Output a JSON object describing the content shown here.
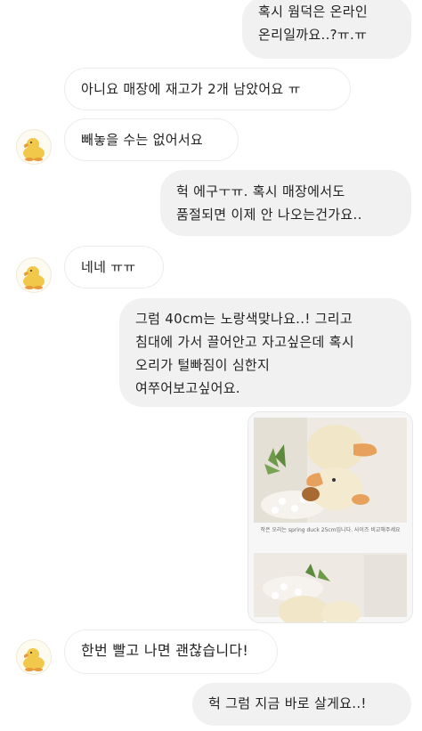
{
  "messages": [
    {
      "id": "m1",
      "side": "sent",
      "text": "혹시 웜덕은 온라인\n온리일까요..?ㅠ.ㅠ"
    },
    {
      "id": "m2",
      "side": "received",
      "text": "아니요 매장에 재고가 2개 남았어요 ㅠ"
    },
    {
      "id": "m3",
      "side": "received",
      "text": "빼놓을 수는 없어서요"
    },
    {
      "id": "m4",
      "side": "sent",
      "text": "헉 에구ㅜㅠ. 혹시 매장에서도\n품절되면 이제 안 나오는건가요.."
    },
    {
      "id": "m5",
      "side": "received",
      "text": "네네 ㅠㅠ"
    },
    {
      "id": "m6",
      "side": "sent",
      "text": "그럼 40cm는 노랑색맞나요..! 그리고\n침대에 가서 끌어안고 자고싶은데 혹시\n오리가 털빠짐이 심한지\n여쭈어보고싶어요."
    },
    {
      "id": "m8",
      "side": "received",
      "text": "한번 빨고 나면 괜찮습니다!"
    },
    {
      "id": "m9",
      "side": "sent",
      "text": "헉 그럼 지금 바로 살게요..!"
    }
  ],
  "photo": {
    "caption": "작은 오리는 spring duck 25cm입니다. 사이즈 비교해주세요",
    "plush_color": "#f1e6c8",
    "beak_color": "#e8a15c"
  },
  "colors": {
    "sent_bubble": "#f1f1f1",
    "received_bubble": "#ffffff",
    "avatar_duck": "#f2c84b"
  }
}
